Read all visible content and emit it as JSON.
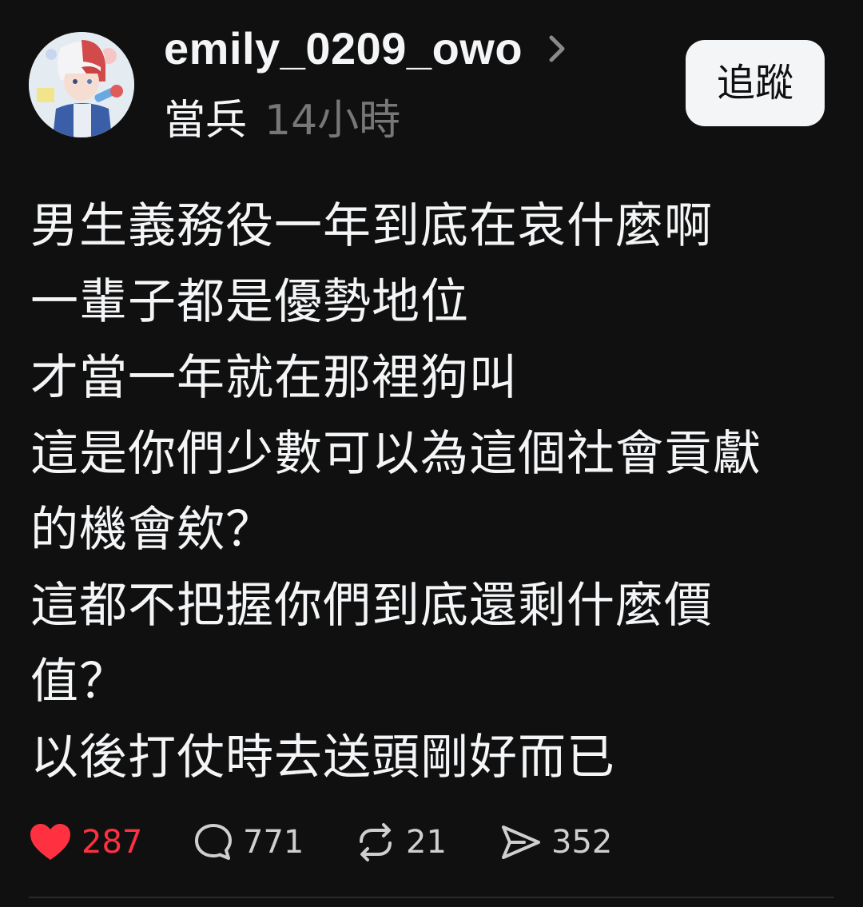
{
  "post": {
    "username": "emily_0209_owo",
    "topic": "當兵",
    "time": "14小時",
    "follow_label": "追蹤",
    "lines": [
      "男生義務役一年到底在哀什麼啊",
      "一輩子都是優勢地位",
      "才當一年就在那裡狗叫",
      "這是你們少數可以為這個社會貢獻",
      "的機會欸？",
      "這都不把握你們到底還剩什麼價",
      "值？",
      "以後打仗時去送頭剛好而已"
    ]
  },
  "actions": {
    "likes": "287",
    "comments": "771",
    "reposts": "21",
    "shares": "352"
  },
  "colors": {
    "background": "#101010",
    "text": "#f3f5f7",
    "muted": "#777777",
    "like": "#ff3040",
    "button_bg": "#f3f5f7"
  },
  "icons": {
    "avatar": "anime-avatar-image",
    "chevron": "chevron-right-icon",
    "like": "heart-filled-icon",
    "comment": "comment-bubble-icon",
    "repost": "repost-arrows-icon",
    "share": "send-icon"
  }
}
